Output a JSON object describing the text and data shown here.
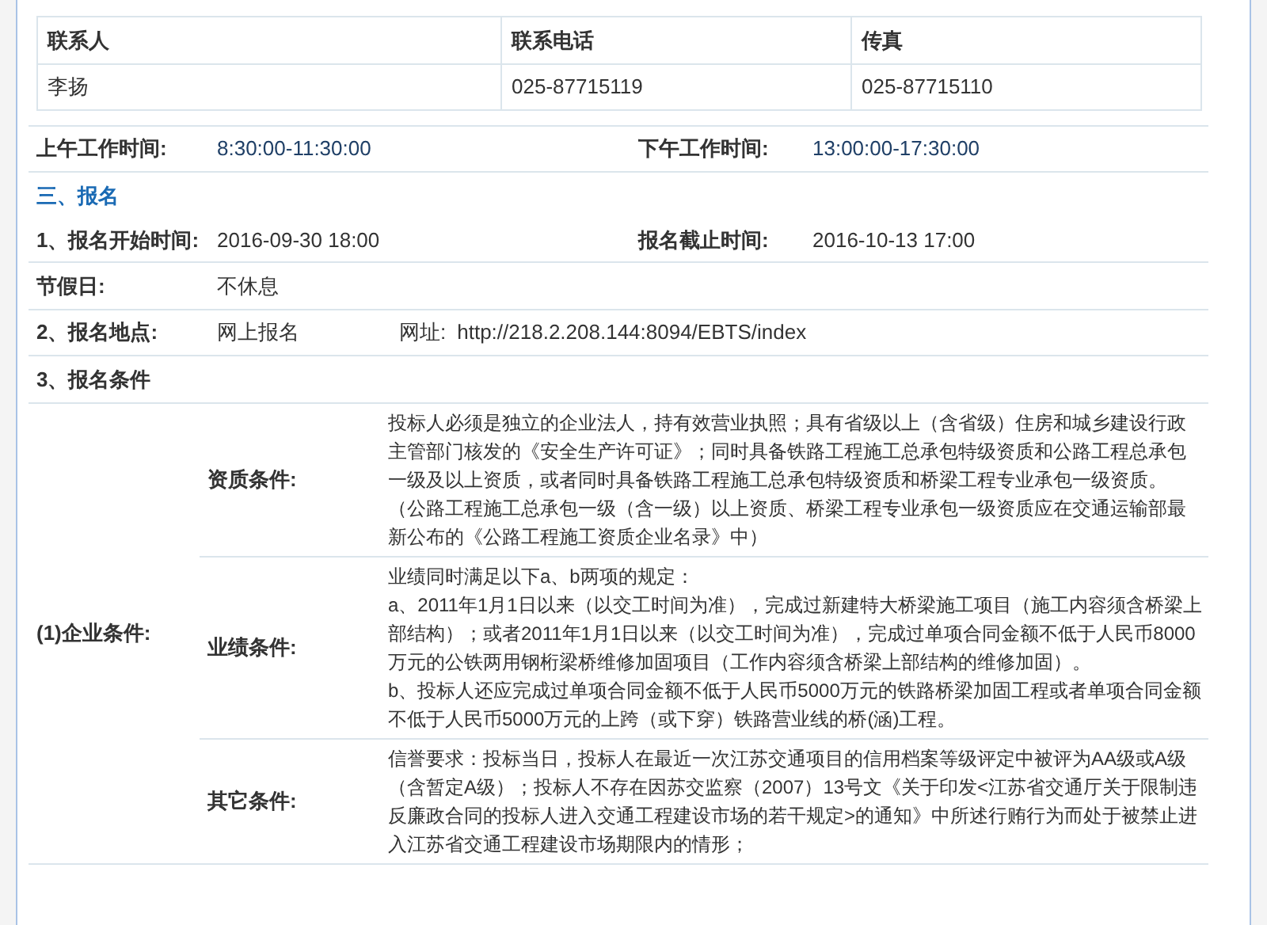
{
  "contacts": {
    "columns": [
      "联系人",
      "联系电话",
      "传真"
    ],
    "rows": [
      [
        "李扬",
        "025-87715119",
        "025-87715110"
      ]
    ]
  },
  "work_hours": [
    {
      "label": "上午工作时间:",
      "value": "8:30:00-11:30:00"
    },
    {
      "label": "下午工作时间:",
      "value": "13:00:00-17:30:00"
    }
  ],
  "section_title": "三、报名",
  "registration_time": [
    {
      "label": "1、报名开始时间:",
      "value": "2016-09-30 18:00"
    },
    {
      "label": "报名截止时间:",
      "value": "2016-10-13 17:00"
    }
  ],
  "holiday": {
    "label": "节假日:",
    "value": "不休息"
  },
  "location": {
    "label": "2、报名地点:",
    "value": "网上报名",
    "url_label": "网址:",
    "url": "http://218.2.208.144:8094/EBTS/index"
  },
  "conditions_title": "3、报名条件",
  "enterprise": {
    "label": "(1)企业条件:",
    "items": [
      {
        "label": "资质条件:",
        "paragraphs": [
          "投标人必须是独立的企业法人，持有效营业执照；具有省级以上（含省级）住房和城乡建设行政主管部门核发的《安全生产许可证》；同时具备铁路工程施工总承包特级资质和公路工程总承包一级及以上资质，或者同时具备铁路工程施工总承包特级资质和桥梁工程专业承包一级资质。（公路工程施工总承包一级（含一级）以上资质、桥梁工程专业承包一级资质应在交通运输部最新公布的《公路工程施工资质企业名录》中）"
        ]
      },
      {
        "label": "业绩条件:",
        "paragraphs": [
          "业绩同时满足以下a、b两项的规定：",
          "a、2011年1月1日以来（以交工时间为准），完成过新建特大桥梁施工项目（施工内容须含桥梁上部结构）；或者2011年1月1日以来（以交工时间为准），完成过单项合同金额不低于人民币8000万元的公铁两用钢桁梁桥维修加固项目（工作内容须含桥梁上部结构的维修加固）。",
          "b、投标人还应完成过单项合同金额不低于人民币5000万元的铁路桥梁加固工程或者单项合同金额不低于人民币5000万元的上跨（或下穿）铁路营业线的桥(涵)工程。"
        ]
      },
      {
        "label": "其它条件:",
        "paragraphs": [
          "信誉要求：投标当日，投标人在最近一次江苏交通项目的信用档案等级评定中被评为AA级或A级（含暂定A级）；投标人不存在因苏交监察（2007）13号文《关于印发<江苏省交通厅关于限制违反廉政合同的投标人进入交通工程建设市场的若干规定>的通知》中所述行贿行为而处于被禁止进入江苏省交通工程建设市场期限内的情形；"
        ]
      }
    ]
  }
}
